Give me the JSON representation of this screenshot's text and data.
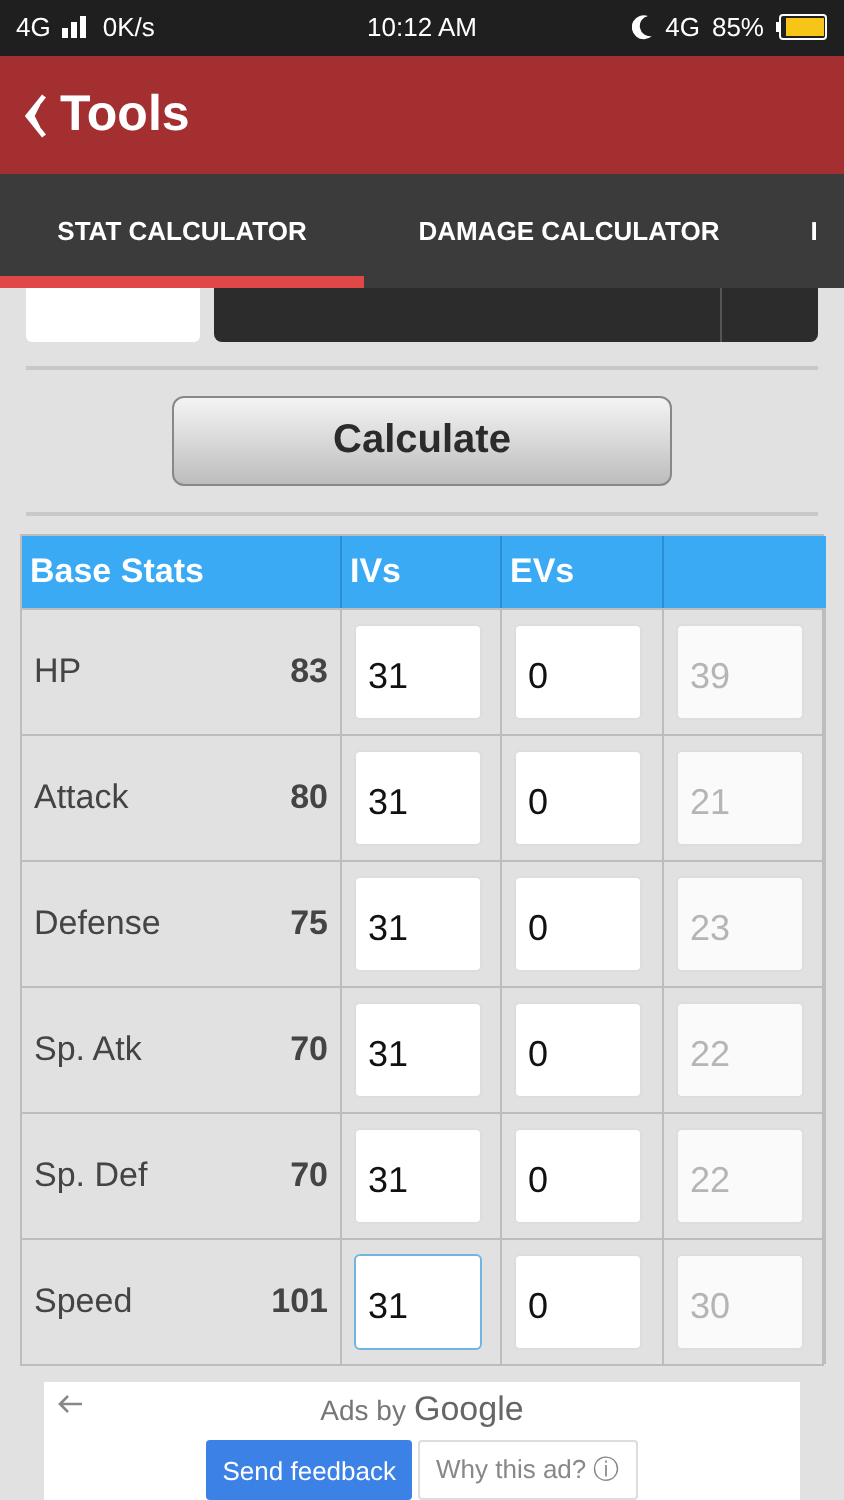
{
  "status_bar": {
    "network": "4G",
    "speed": "0K/s",
    "time": "10:12 AM",
    "network_right": "4G",
    "battery": "85%"
  },
  "app_bar": {
    "title": "Tools"
  },
  "tabs": [
    {
      "label": "STAT CALCULATOR",
      "selected": true
    },
    {
      "label": "DAMAGE CALCULATOR",
      "selected": false
    },
    {
      "label": "I",
      "selected": false
    }
  ],
  "calculate_button": "Calculate",
  "table": {
    "columns": [
      "Base Stats",
      "IVs",
      "EVs"
    ],
    "rows": [
      {
        "name": "HP",
        "base": "83",
        "iv": "31",
        "ev": "0",
        "stat": "39",
        "focused": false
      },
      {
        "name": "Attack",
        "base": "80",
        "iv": "31",
        "ev": "0",
        "stat": "21",
        "focused": false
      },
      {
        "name": "Defense",
        "base": "75",
        "iv": "31",
        "ev": "0",
        "stat": "23",
        "focused": false
      },
      {
        "name": "Sp. Atk",
        "base": "70",
        "iv": "31",
        "ev": "0",
        "stat": "22",
        "focused": false
      },
      {
        "name": "Sp. Def",
        "base": "70",
        "iv": "31",
        "ev": "0",
        "stat": "22",
        "focused": false
      },
      {
        "name": "Speed",
        "base": "101",
        "iv": "31",
        "ev": "0",
        "stat": "30",
        "focused": true
      }
    ]
  },
  "ad": {
    "prefix": "Ads by",
    "brand": "Google",
    "feedback_button": "Send feedback",
    "why_button": "Why this ad? ⓘ"
  }
}
